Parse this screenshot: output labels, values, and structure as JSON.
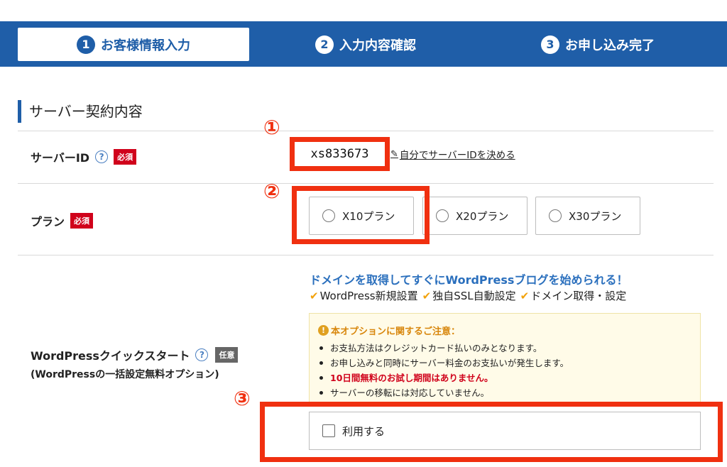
{
  "steps": [
    {
      "num": "1",
      "label": "お客様情報入力",
      "active": true
    },
    {
      "num": "2",
      "label": "入力内容確認",
      "active": false
    },
    {
      "num": "3",
      "label": "お申し込み完了",
      "active": false
    }
  ],
  "section_title": "サーバー契約内容",
  "server_id": {
    "label": "サーバーID",
    "help": "?",
    "required": "必須",
    "value": "xs833673",
    "edit_link": "自分でサーバーIDを決める"
  },
  "markers": {
    "one": "①",
    "two": "②",
    "three": "③"
  },
  "plan": {
    "label": "プラン",
    "required": "必須",
    "options": [
      {
        "label": "X10プラン"
      },
      {
        "label": "X20プラン"
      },
      {
        "label": "X30プラン"
      }
    ]
  },
  "wordpress": {
    "label": "WordPressクイックスタート",
    "help": "?",
    "optional": "任意",
    "sublabel": "(WordPressの一括設定無料オプション)",
    "headline": "ドメインを取得してすぐにWordPressブログを始められる！",
    "features": [
      "WordPress新規設置",
      "独自SSL自動設定",
      "ドメイン取得・設定"
    ],
    "notice_title": "本オプションに関するご注意：",
    "notice_items": [
      "お支払方法はクレジットカード払いのみとなります。",
      "お申し込みと同時にサーバー料金のお支払いが発生します。",
      "10日間無料のお試し期間はありません。",
      "サーバーの移転には対応していません。"
    ],
    "use_label": "利用する"
  },
  "colors": {
    "brand_blue": "#1f5ea8",
    "highlight_red": "#f03010",
    "required_red": "#d0021b",
    "check_orange": "#f2a20c"
  }
}
